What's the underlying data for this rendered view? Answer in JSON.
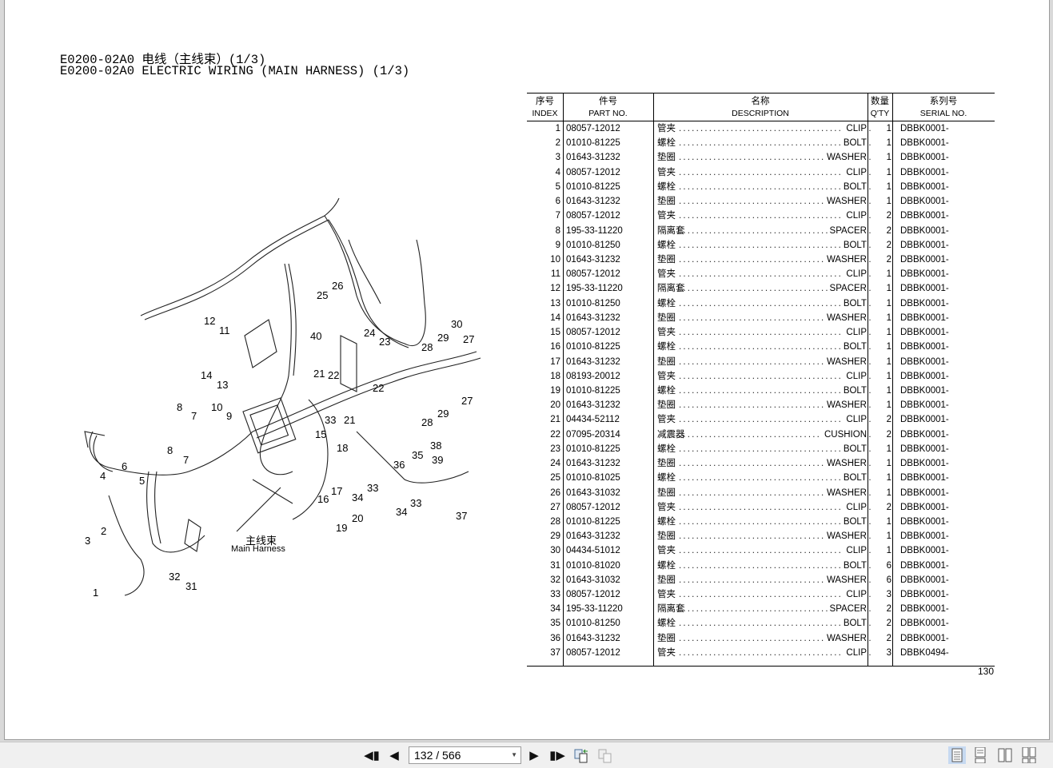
{
  "document": {
    "title_cn": "E0200-02A0 电线（主线束）(1/3)",
    "title_en": "E0200-02A0 ELECTRIC WIRING (MAIN HARNESS) (1/3)",
    "page_number": "130"
  },
  "diagram": {
    "harness_label_cn": "主线束",
    "harness_label_en": "Main Harness",
    "callouts": [
      "26",
      "25",
      "12",
      "11",
      "40",
      "24",
      "23",
      "30",
      "29",
      "27",
      "28",
      "14",
      "13",
      "21",
      "22",
      "22",
      "8",
      "10",
      "7",
      "9",
      "33",
      "21",
      "27",
      "29",
      "28",
      "15",
      "18",
      "38",
      "39",
      "35",
      "36",
      "8",
      "7",
      "6",
      "5",
      "4",
      "17",
      "33",
      "34",
      "16",
      "33",
      "34",
      "37",
      "20",
      "19",
      "2",
      "3",
      "32",
      "31",
      "1"
    ]
  },
  "table": {
    "headers": {
      "index_cn": "序号",
      "index_en": "INDEX",
      "part_cn": "件号",
      "part_en": "PART NO.",
      "desc_cn": "名称",
      "desc_en": "DESCRIPTION",
      "qty_cn": "数量",
      "qty_en": "Q'TY",
      "serial_cn": "系列号",
      "serial_en": "SERIAL NO."
    },
    "dot_leader": "..............................................",
    "rows": [
      {
        "index": "1",
        "part": "08057-12012",
        "cn": "管夹",
        "en": "CLIP",
        "qty": "1",
        "serial": "DBBK0001-"
      },
      {
        "index": "2",
        "part": "01010-81225",
        "cn": "螺栓",
        "en": "BOLT",
        "qty": "1",
        "serial": "DBBK0001-"
      },
      {
        "index": "3",
        "part": "01643-31232",
        "cn": "垫圈",
        "en": "WASHER",
        "qty": "1",
        "serial": "DBBK0001-"
      },
      {
        "index": "4",
        "part": "08057-12012",
        "cn": "管夹",
        "en": "CLIP",
        "qty": "1",
        "serial": "DBBK0001-"
      },
      {
        "index": "5",
        "part": "01010-81225",
        "cn": "螺栓",
        "en": "BOLT",
        "qty": "1",
        "serial": "DBBK0001-"
      },
      {
        "index": "6",
        "part": "01643-31232",
        "cn": "垫圈",
        "en": "WASHER",
        "qty": "1",
        "serial": "DBBK0001-"
      },
      {
        "index": "7",
        "part": "08057-12012",
        "cn": "管夹",
        "en": "CLIP",
        "qty": "2",
        "serial": "DBBK0001-"
      },
      {
        "index": "8",
        "part": "195-33-11220",
        "cn": "隔离套",
        "en": "SPACER",
        "qty": "2",
        "serial": "DBBK0001-"
      },
      {
        "index": "9",
        "part": "01010-81250",
        "cn": "螺栓",
        "en": "BOLT",
        "qty": "2",
        "serial": "DBBK0001-"
      },
      {
        "index": "10",
        "part": "01643-31232",
        "cn": "垫圈",
        "en": "WASHER",
        "qty": "2",
        "serial": "DBBK0001-"
      },
      {
        "index": "11",
        "part": "08057-12012",
        "cn": "管夹",
        "en": "CLIP",
        "qty": "1",
        "serial": "DBBK0001-"
      },
      {
        "index": "12",
        "part": "195-33-11220",
        "cn": "隔离套",
        "en": "SPACER",
        "qty": "1",
        "serial": "DBBK0001-"
      },
      {
        "index": "13",
        "part": "01010-81250",
        "cn": "螺栓",
        "en": "BOLT",
        "qty": "1",
        "serial": "DBBK0001-"
      },
      {
        "index": "14",
        "part": "01643-31232",
        "cn": "垫圈",
        "en": "WASHER",
        "qty": "1",
        "serial": "DBBK0001-"
      },
      {
        "index": "15",
        "part": "08057-12012",
        "cn": "管夹",
        "en": "CLIP",
        "qty": "1",
        "serial": "DBBK0001-"
      },
      {
        "index": "16",
        "part": "01010-81225",
        "cn": "螺栓",
        "en": "BOLT",
        "qty": "1",
        "serial": "DBBK0001-"
      },
      {
        "index": "17",
        "part": "01643-31232",
        "cn": "垫圈",
        "en": "WASHER",
        "qty": "1",
        "serial": "DBBK0001-"
      },
      {
        "index": "18",
        "part": "08193-20012",
        "cn": "管夹",
        "en": "CLIP",
        "qty": "1",
        "serial": "DBBK0001-"
      },
      {
        "index": "19",
        "part": "01010-81225",
        "cn": "螺栓",
        "en": "BOLT",
        "qty": "1",
        "serial": "DBBK0001-"
      },
      {
        "index": "20",
        "part": "01643-31232",
        "cn": "垫圈",
        "en": "WASHER",
        "qty": "1",
        "serial": "DBBK0001-"
      },
      {
        "index": "21",
        "part": "04434-52112",
        "cn": "管夹",
        "en": "CLIP",
        "qty": "2",
        "serial": "DBBK0001-"
      },
      {
        "index": "22",
        "part": "07095-20314",
        "cn": "减震器",
        "en": "CUSHION",
        "qty": "2",
        "serial": "DBBK0001-"
      },
      {
        "index": "23",
        "part": "01010-81225",
        "cn": "螺栓",
        "en": "BOLT",
        "qty": "1",
        "serial": "DBBK0001-"
      },
      {
        "index": "24",
        "part": "01643-31232",
        "cn": "垫圈",
        "en": "WASHER",
        "qty": "1",
        "serial": "DBBK0001-"
      },
      {
        "index": "25",
        "part": "01010-81025",
        "cn": "螺栓",
        "en": "BOLT",
        "qty": "1",
        "serial": "DBBK0001-"
      },
      {
        "index": "26",
        "part": "01643-31032",
        "cn": "垫圈",
        "en": "WASHER",
        "qty": "1",
        "serial": "DBBK0001-"
      },
      {
        "index": "27",
        "part": "08057-12012",
        "cn": "管夹",
        "en": "CLIP",
        "qty": "2",
        "serial": "DBBK0001-"
      },
      {
        "index": "28",
        "part": "01010-81225",
        "cn": "螺栓",
        "en": "BOLT",
        "qty": "1",
        "serial": "DBBK0001-"
      },
      {
        "index": "29",
        "part": "01643-31232",
        "cn": "垫圈",
        "en": "WASHER",
        "qty": "1",
        "serial": "DBBK0001-"
      },
      {
        "index": "30",
        "part": "04434-51012",
        "cn": "管夹",
        "en": "CLIP",
        "qty": "1",
        "serial": "DBBK0001-"
      },
      {
        "index": "31",
        "part": "01010-81020",
        "cn": "螺栓",
        "en": "BOLT",
        "qty": "6",
        "serial": "DBBK0001-"
      },
      {
        "index": "32",
        "part": "01643-31032",
        "cn": "垫圈",
        "en": "WASHER",
        "qty": "6",
        "serial": "DBBK0001-"
      },
      {
        "index": "33",
        "part": "08057-12012",
        "cn": "管夹",
        "en": "CLIP",
        "qty": "3",
        "serial": "DBBK0001-"
      },
      {
        "index": "34",
        "part": "195-33-11220",
        "cn": "隔离套",
        "en": "SPACER",
        "qty": "2",
        "serial": "DBBK0001-"
      },
      {
        "index": "35",
        "part": "01010-81250",
        "cn": "螺栓",
        "en": "BOLT",
        "qty": "2",
        "serial": "DBBK0001-"
      },
      {
        "index": "36",
        "part": "01643-31232",
        "cn": "垫圈",
        "en": "WASHER",
        "qty": "2",
        "serial": "DBBK0001-"
      },
      {
        "index": "37",
        "part": "08057-12012",
        "cn": "管夹",
        "en": "CLIP",
        "qty": "3",
        "serial": "DBBK0494-"
      }
    ]
  },
  "toolbar": {
    "page_selector_value": "132 / 566",
    "icons": [
      "first-page-icon",
      "previous-page-icon",
      "next-page-icon",
      "last-page-icon",
      "go-back-view-icon",
      "go-forward-view-icon",
      "single-page-view-icon",
      "continuous-view-icon",
      "facing-view-icon",
      "continuous-facing-view-icon"
    ]
  }
}
